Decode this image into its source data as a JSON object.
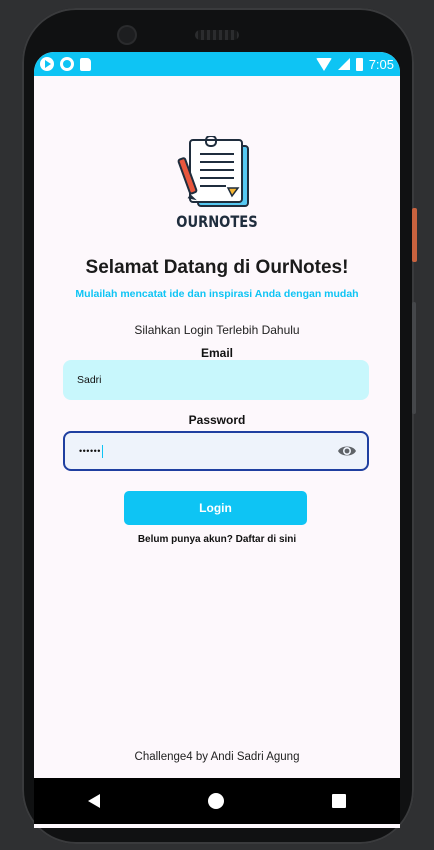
{
  "statusbar": {
    "time": "7:05",
    "left_icons": [
      "play-icon",
      "record-icon",
      "sd-card-icon"
    ],
    "right_icons": [
      "wifi-icon",
      "signal-icon",
      "battery-icon"
    ]
  },
  "app": {
    "brand": "OURNOTES",
    "title": "Selamat Datang di OurNotes!",
    "subtitle": "Mulailah mencatat ide dan inspirasi Anda dengan mudah",
    "prompt": "Silahkan Login Terlebih Dahulu",
    "email_label": "Email",
    "email_value": "Sadri",
    "password_label": "Password",
    "password_value": "••••••",
    "login_label": "Login",
    "signup_text": "Belum punya akun? Daftar di sini",
    "footer": "Challenge4 by Andi Sadri Agung"
  },
  "colors": {
    "accent": "#0ec4f4",
    "email_field_bg": "#c8f7fc",
    "password_border": "#1f3fa0",
    "screen_bg": "#fdf8fc"
  }
}
